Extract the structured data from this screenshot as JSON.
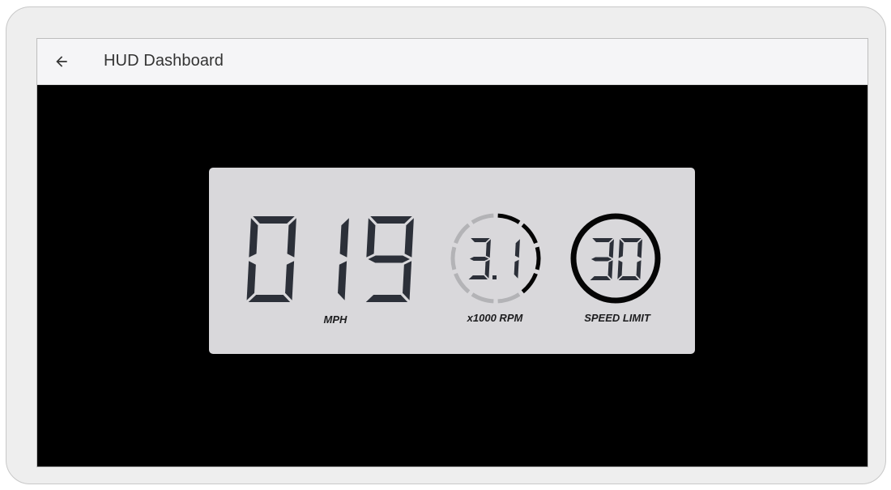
{
  "app": {
    "title": "HUD Dashboard"
  },
  "nav": {
    "back_icon": "arrow-back-icon"
  },
  "hud": {
    "speed": {
      "value": "019",
      "unit_label": "MPH"
    },
    "rpm": {
      "value": "3.1",
      "unit_label": "x1000 RPM",
      "arc_fraction": 0.44
    },
    "speed_limit": {
      "value": "30",
      "label": "SPEED LIMIT"
    }
  },
  "colors": {
    "screen_bg": "#000000",
    "hud_panel": "#d9d8db",
    "digit_on": "#2c3039",
    "digit_off": "#cfced3",
    "ring_active": "#050505",
    "ring_inactive": "#b3b3b6",
    "appbar_bg": "#f5f5f7"
  }
}
